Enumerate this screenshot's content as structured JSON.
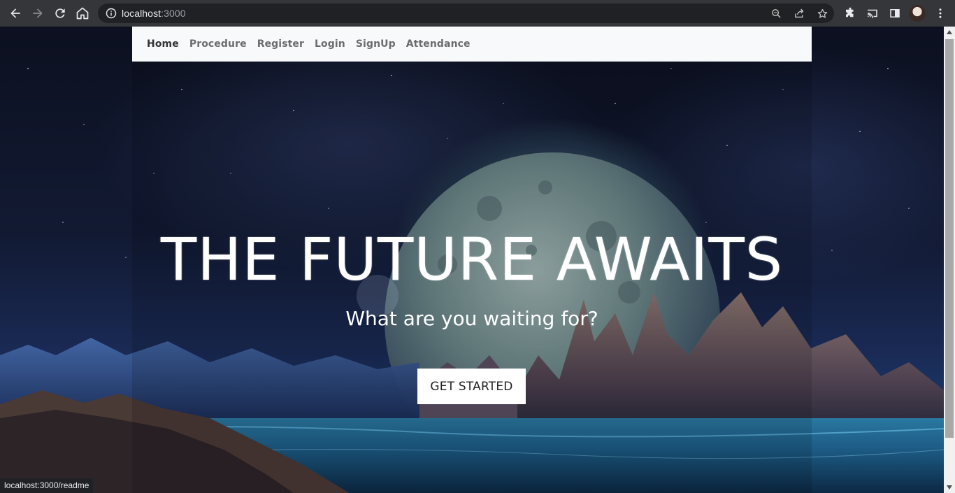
{
  "browser": {
    "url_host": "localhost",
    "url_port": ":3000",
    "status_url": "localhost:3000/readme"
  },
  "navbar": {
    "links": [
      {
        "label": "Home",
        "active": true
      },
      {
        "label": "Procedure"
      },
      {
        "label": "Register"
      },
      {
        "label": "Login"
      },
      {
        "label": "SignUp"
      },
      {
        "label": "Attendance"
      }
    ]
  },
  "hero": {
    "title": "THE FUTURE AWAITS",
    "subtitle": "What are you waiting for?",
    "cta_label": "GET STARTED"
  },
  "icons": {
    "back": "back-arrow-icon",
    "forward": "forward-arrow-icon",
    "reload": "reload-icon",
    "home": "home-icon",
    "site_info": "info-icon",
    "zoom": "zoom-icon",
    "share": "share-icon",
    "bookmark": "star-icon",
    "extensions": "puzzle-icon",
    "cast": "cast-icon",
    "side_panel": "side-panel-icon",
    "menu": "kebab-menu-icon"
  },
  "colors": {
    "chrome_bg": "#35363a",
    "omnibox_bg": "#202124",
    "navbar_bg": "#f8f9fa",
    "nav_link": "#6c6c6c",
    "nav_link_active": "#333333",
    "hero_text": "#ffffff",
    "button_bg": "#ffffff"
  }
}
